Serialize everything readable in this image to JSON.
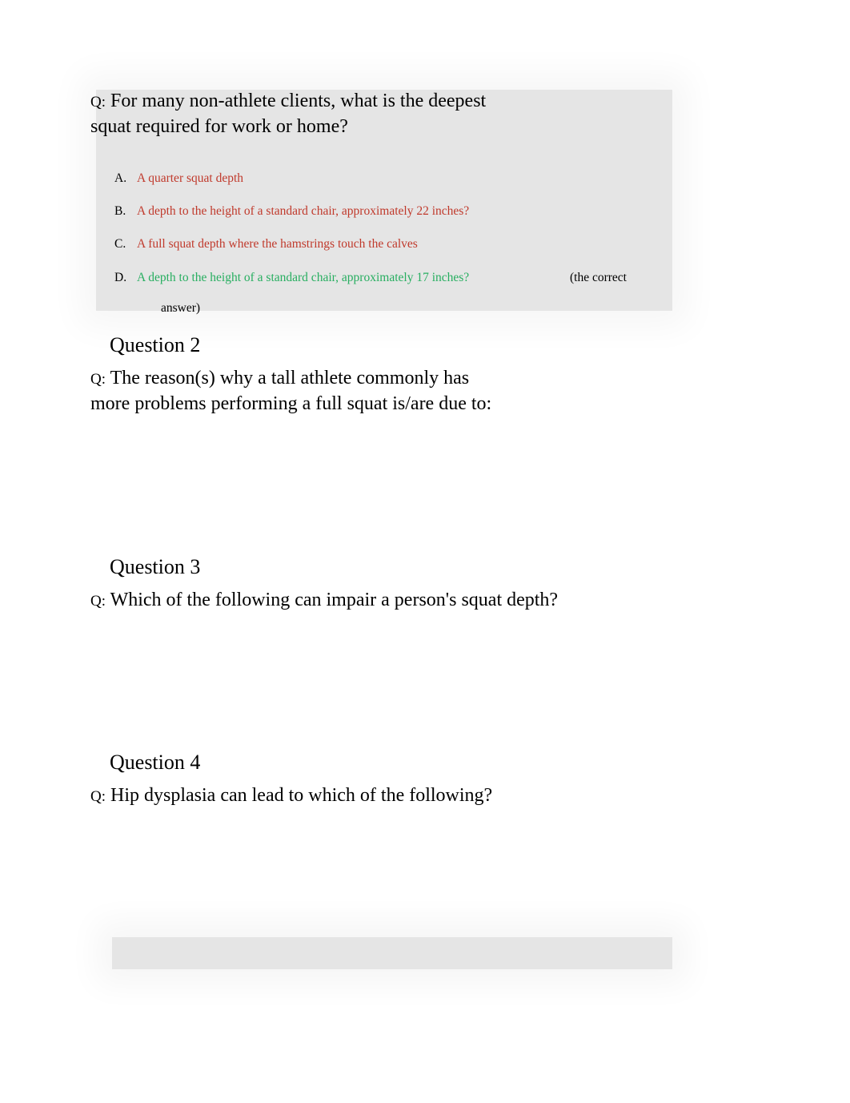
{
  "q1": {
    "prefix": "Q:",
    "text": "For many non-athlete clients, what is the deepest squat required for work or home?",
    "answers": {
      "a": {
        "letter": "A.",
        "text": "A quarter squat depth"
      },
      "b": {
        "letter": "B.",
        "text": "A depth to the height of a standard chair, approximately 22 inches?"
      },
      "c": {
        "letter": "C.",
        "text": "A full squat depth where the hamstrings touch the calves"
      },
      "d": {
        "letter": "D.",
        "text": "A depth to the height of a standard chair, approximately 17 inches?",
        "note_start": "(the correct",
        "note_end": "answer)"
      }
    }
  },
  "q2": {
    "heading": "Question 2",
    "prefix": "Q:",
    "text": "The reason(s) why a tall athlete commonly has more problems performing a full squat is/are due to:"
  },
  "q3": {
    "heading": "Question 3",
    "prefix": "Q:",
    "text": "Which of the following can impair a person's squat depth?"
  },
  "q4": {
    "heading": "Question 4",
    "prefix": "Q:",
    "text": "Hip dysplasia can lead to which of the following?"
  }
}
